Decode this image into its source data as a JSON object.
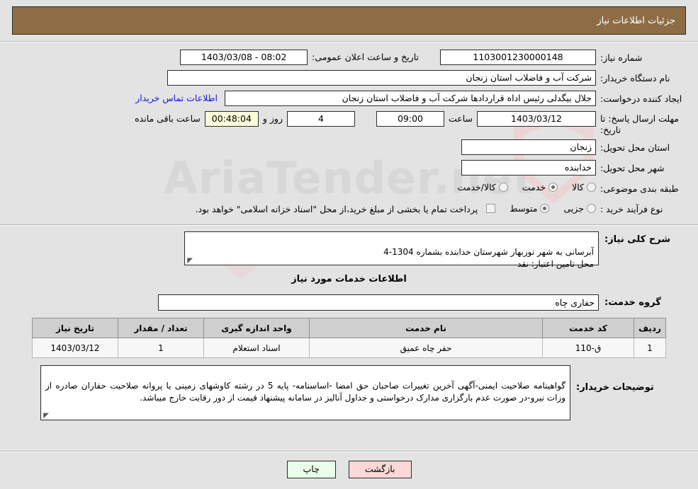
{
  "header": {
    "title": "جزئیات اطلاعات نیاز",
    "bar_color": "#8c6d46"
  },
  "watermark": {
    "text": "AriaTender.net"
  },
  "form": {
    "need_number_label": "شماره نیاز:",
    "need_number_value": "1103001230000148",
    "public_announce_label": "تاریخ و ساعت اعلان عمومی:",
    "public_announce_value": "08:02 - 1403/03/08",
    "buyer_org_label": "نام دستگاه خریدار:",
    "buyer_org_value": "شرکت آب و فاضلاب استان زنجان",
    "requester_label": "ایجاد کننده درخواست:",
    "requester_value": "جلال بیگدلی رئیس اداه قراردادها شرکت آب و فاضلاب استان زنجان",
    "contact_link": "اطلاعات تماس خریدار",
    "deadline_label": "مهلت ارسال پاسخ: تا تاریخ:",
    "deadline_date": "1403/03/12",
    "time_label": "ساعت",
    "deadline_time": "09:00",
    "days_remaining": "4",
    "days_label": "روز و",
    "countdown": "00:48:04",
    "countdown_suffix": "ساعت باقی مانده",
    "province_label": "استان محل تحویل:",
    "province_value": "زنجان",
    "city_label": "شهر محل تحویل:",
    "city_value": "خدابنده",
    "category_label": "طبقه بندی موضوعی:",
    "category_options": [
      {
        "label": "کالا",
        "selected": false
      },
      {
        "label": "خدمت",
        "selected": true
      },
      {
        "label": "کالا/خدمت",
        "selected": false
      }
    ],
    "process_label": "نوع فرآیند خرید :",
    "process_options": [
      {
        "label": "جزیی",
        "selected": false
      },
      {
        "label": "متوسط",
        "selected": true
      }
    ],
    "treasury_checkbox_checked": false,
    "treasury_note": "پرداخت تمام یا بخشی از مبلغ خرید،از محل \"اسناد خزانه اسلامی\" خواهد بود."
  },
  "description": {
    "label": "شرح کلی نیاز:",
    "value": "آبرسانی به شهر نوربهار شهرستان خدابنده بشماره 1304-4\nمحل تامین اعتبار: نقد"
  },
  "services": {
    "section_title": "اطلاعات خدمات مورد نیاز",
    "group_label": "گروه خدمت:",
    "group_value": "حفاری چاه",
    "table": {
      "headers": [
        "ردیف",
        "کد خدمت",
        "نام خدمت",
        "واحد اندازه گیری",
        "تعداد / مقدار",
        "تاریخ نیاز"
      ],
      "rows": [
        [
          "1",
          "ق-110",
          "حفر چاه عمیق",
          "اسناد استعلام",
          "1",
          "1403/03/12"
        ]
      ]
    }
  },
  "remarks": {
    "label": "توضیحات خریدار:",
    "value": "گواهینامه صلاحیت ایمنی-آگهی آخرین تغییرات صاحبان حق امضا -اساسنامه- پایه 5 در رشته کاوشهای زمینی یا پروانه صلاحیت حفاران صادره از وزات نیرو-در صورت عدم بارگزاری مدارک درخواستی و جداول آنالیز در سامانه پیشنهاد قیمت از دور رقابت خارج میباشد."
  },
  "footer": {
    "print_label": "چاپ",
    "back_label": "بازگشت"
  }
}
